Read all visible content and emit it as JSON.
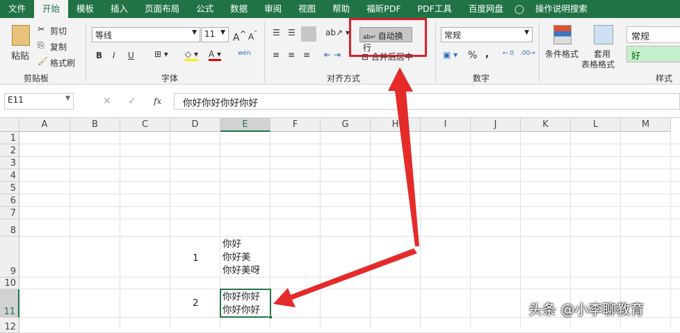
{
  "tabs": [
    "文件",
    "开始",
    "模板",
    "插入",
    "页面布局",
    "公式",
    "数据",
    "审阅",
    "视图",
    "帮助",
    "福昕PDF",
    "PDF工具",
    "百度网盘",
    "操作说明搜索"
  ],
  "clipboard": {
    "paste": "粘贴",
    "cut": "剪切",
    "copy": "复制",
    "format_painter": "格式刷",
    "label": "剪贴板"
  },
  "font": {
    "name": "等线",
    "size": "11",
    "bold": "B",
    "italic": "I",
    "underline": "U",
    "phonetic": "wén",
    "label": "字体"
  },
  "alignment": {
    "wrap_text": "自动换行",
    "merge_center": "合并后居中",
    "label": "对齐方式"
  },
  "number": {
    "format": "常规",
    "percent": "%",
    "comma": ",",
    "label": "数字"
  },
  "styles": {
    "conditional": "条件格式",
    "table_format_1": "套用",
    "table_format_2": "表格格式",
    "normal": "常规",
    "good": "好",
    "label": "样式"
  },
  "formula_bar": {
    "name_box": "E11",
    "fx": "fx",
    "value": "你好你好你好你好"
  },
  "columns": [
    "A",
    "B",
    "C",
    "D",
    "E",
    "F",
    "G",
    "H",
    "I",
    "J",
    "K",
    "L",
    "M"
  ],
  "rows": [
    "1",
    "2",
    "3",
    "4",
    "5",
    "6",
    "7",
    "8",
    "9",
    "10",
    "11",
    "12"
  ],
  "cells": {
    "D9": "1",
    "E9": [
      "你好",
      "你好美",
      "你好美呀"
    ],
    "D11": "2",
    "E11": [
      "你好你好",
      "你好你好"
    ]
  },
  "watermark": "头条 @小李聊教育",
  "colors": {
    "accent": "#217346",
    "highlight": "#e02020"
  }
}
